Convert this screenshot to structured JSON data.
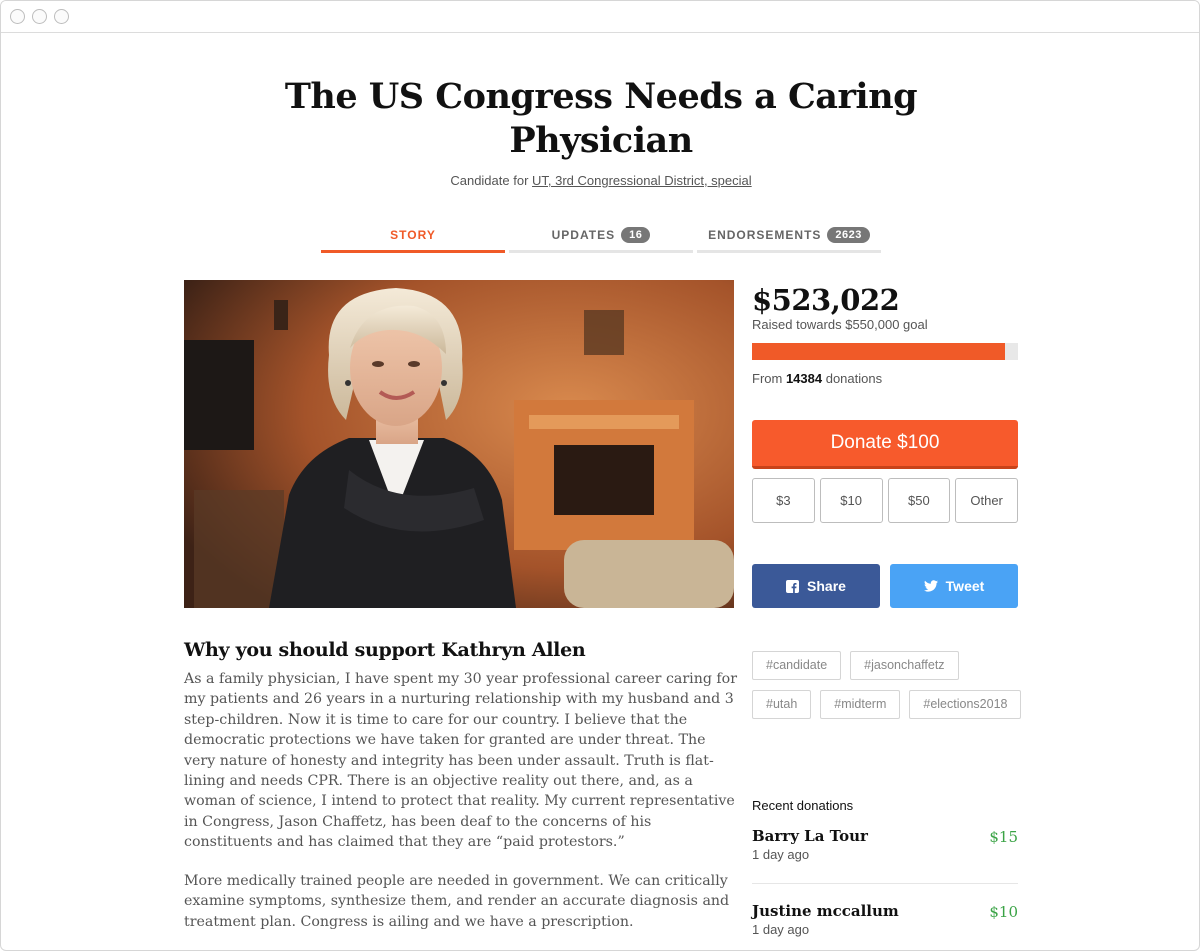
{
  "page": {
    "title": "The US Congress Needs a Caring Physician",
    "subtitle_prefix": "Candidate for ",
    "subtitle_link": "UT, 3rd Congressional District, special"
  },
  "tabs": [
    {
      "label": "STORY",
      "active": true
    },
    {
      "label": "UPDATES",
      "badge": "16"
    },
    {
      "label": "ENDORSEMENTS",
      "badge": "2623"
    }
  ],
  "story": {
    "heading": "Why you should support Kathryn Allen",
    "paragraph1": "As a family physician, I have spent my 30 year professional career caring for my patients and 26 years in a nurturing relationship with my husband and 3 step-children. Now it is time to care for our country. I believe that the democratic protections we have taken for granted are under threat. The very nature of honesty and integrity has been under assault. Truth is flat-lining and needs CPR. There is an objective reality out there, and, as a woman of science, I intend to protect that reality. My current representative in Congress, Jason Chaffetz, has been deaf to the concerns of his constituents and has claimed that they are “paid protestors.”",
    "paragraph2": "More medically trained people are needed in government. We can critically examine symptoms, synthesize them, and render an accurate diagnosis and treatment plan. Congress is ailing and we have a prescription."
  },
  "fundraising": {
    "amount": "$523,022",
    "raised_text": "Raised towards $550,000 goal",
    "progress_percent": 95.1,
    "from_prefix": "From ",
    "donations_count": "14384",
    "from_suffix": " donations",
    "donate_label": "Donate $100",
    "amount_options": [
      "$3",
      "$10",
      "$50",
      "Other"
    ]
  },
  "share": {
    "facebook_label": "Share",
    "twitter_label": "Tweet"
  },
  "tags": [
    "#candidate",
    "#jasonchaffetz",
    "#utah",
    "#midterm",
    "#elections2018"
  ],
  "recent": {
    "heading": "Recent donations",
    "items": [
      {
        "name": "Barry La Tour",
        "time": "1 day ago",
        "amount": "$15"
      },
      {
        "name": "Justine mccallum",
        "time": "1 day ago",
        "amount": "$10"
      }
    ]
  },
  "colors": {
    "accent": "#f05a28",
    "facebook": "#3b5998",
    "twitter": "#4aa3f5",
    "donation_amount": "#3aa345"
  }
}
